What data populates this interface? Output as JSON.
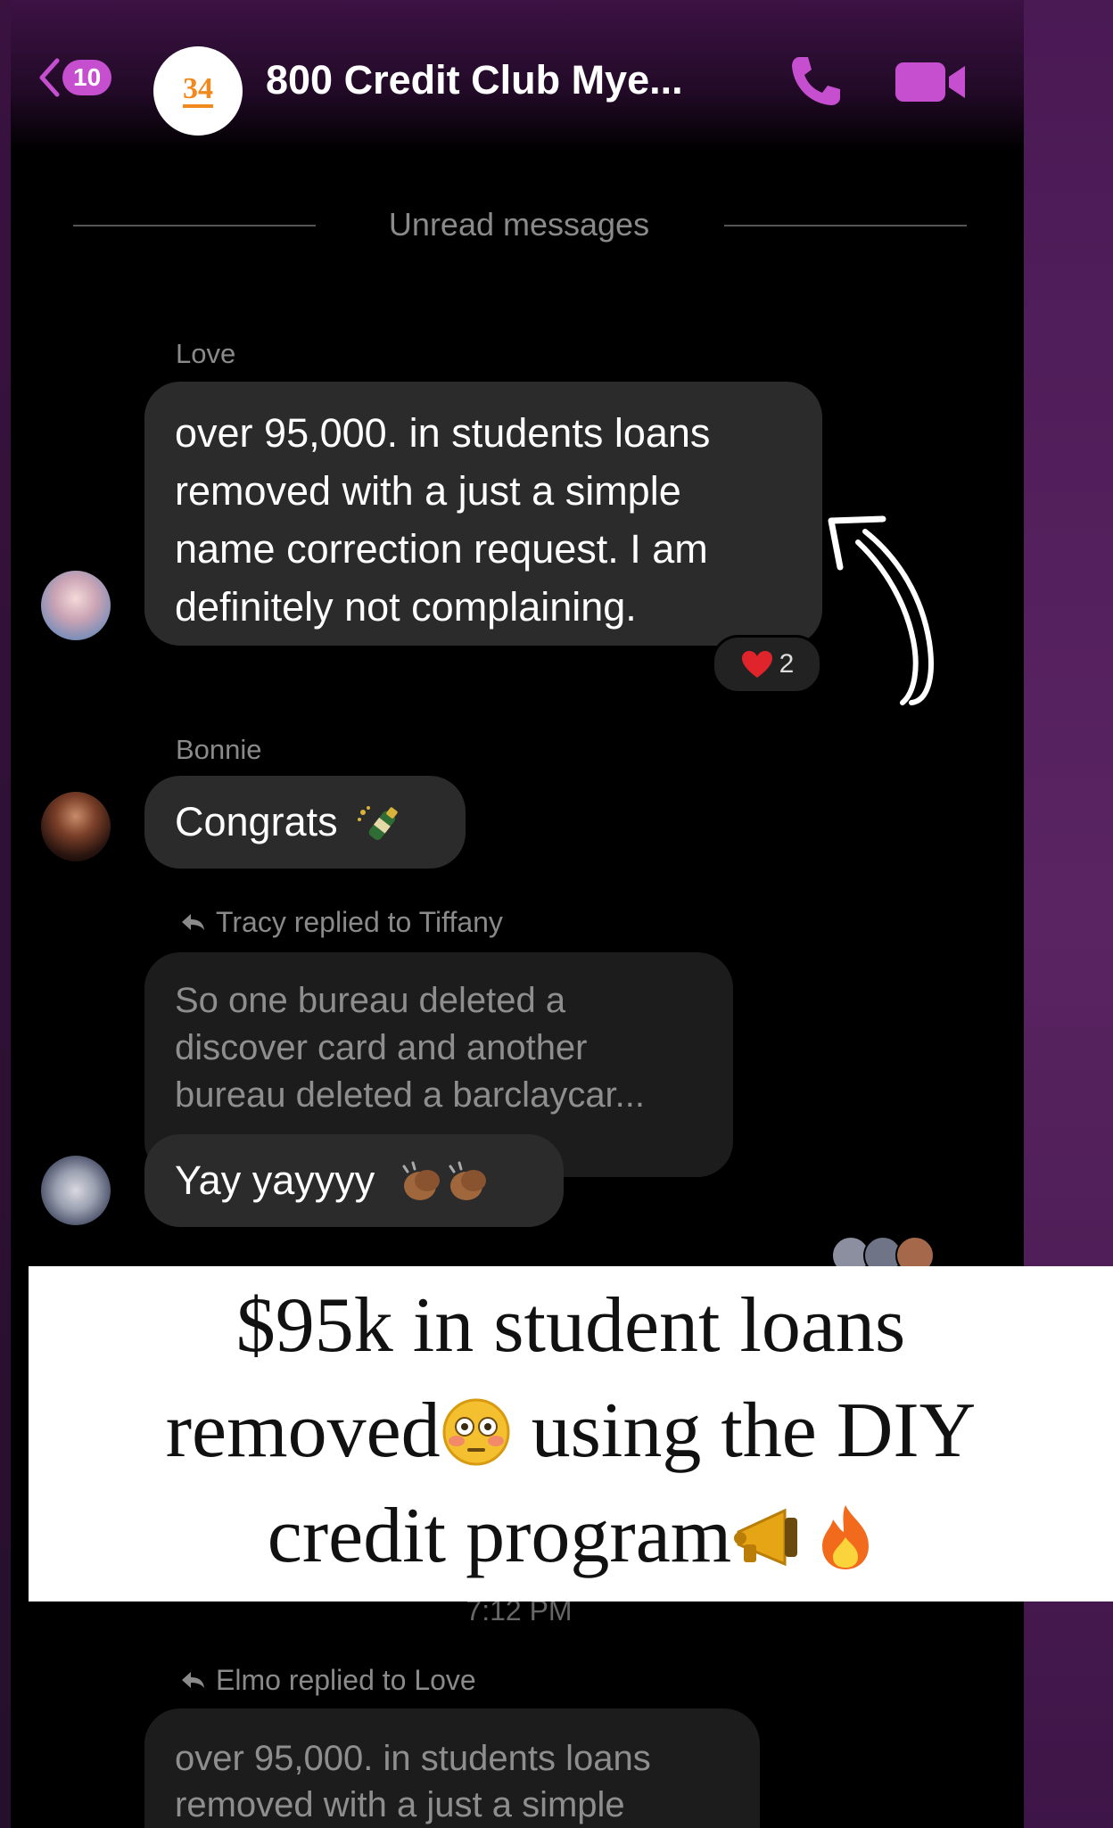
{
  "header": {
    "back_count": "10",
    "group_avatar_text": "34",
    "title": "800 Credit Club Mye..."
  },
  "divider": {
    "label": "Unread messages"
  },
  "messages": [
    {
      "sender": "Love",
      "text_lines": [
        "over 95,000. in students loans",
        "removed with a just a simple",
        "name correction request. I am",
        "definitely not complaining."
      ],
      "reaction_icon": "heart-icon",
      "reaction_count": "2"
    },
    {
      "sender": "Bonnie",
      "text": "Congrats",
      "emoji": "champagne-icon"
    },
    {
      "reply_label": "Tracy replied to Tiffany",
      "quoted_lines": [
        "So one bureau deleted a",
        "discover card and another",
        "bureau deleted a barclaycar..."
      ],
      "text": "Yay yayyyy",
      "emoji": "clapping-hands-icon"
    }
  ],
  "overlay": {
    "line1": "$95k in student loans",
    "line2_a": "removed",
    "line2_b": " using the DIY",
    "line3": "credit program"
  },
  "timestamp": "7:12 PM",
  "bottom_reply": {
    "reply_label": "Elmo replied to Love",
    "quoted_lines": [
      "over 95,000. in students loans",
      "removed with a just a simple"
    ]
  },
  "colors": {
    "accent": "#c64fd0",
    "bubble": "#2b2b2b",
    "quoted_bubble": "#1c1c1c",
    "background": "#000000",
    "reaction_heart": "#e0242c"
  }
}
